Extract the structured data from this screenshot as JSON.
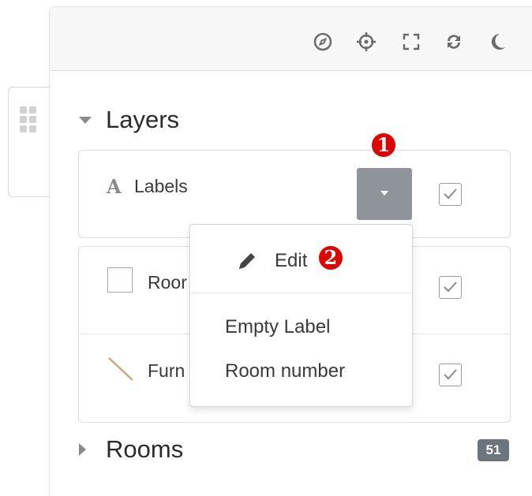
{
  "toolbar": {
    "icons": [
      "compass-icon",
      "crosshair-icon",
      "fullscreen-icon",
      "refresh-icon",
      "moon-icon"
    ]
  },
  "layers": {
    "title": "Layers",
    "rows": [
      {
        "label": "Labels",
        "icon": "text-icon",
        "checked": true
      },
      {
        "label": "Roor",
        "icon": "square-icon",
        "checked": true
      },
      {
        "label": "Furn",
        "icon": "line-icon",
        "checked": true
      }
    ]
  },
  "dropdown": {
    "items": [
      "Edit",
      "Empty Label",
      "Room number"
    ],
    "edit_icon": "pencil-icon"
  },
  "rooms": {
    "title": "Rooms",
    "count": "51"
  },
  "annotations": {
    "step1": "1",
    "step2": "2"
  },
  "colors": {
    "accent_button": "#8e949a",
    "annotation": "#e00000",
    "badge": "#6c757d"
  }
}
